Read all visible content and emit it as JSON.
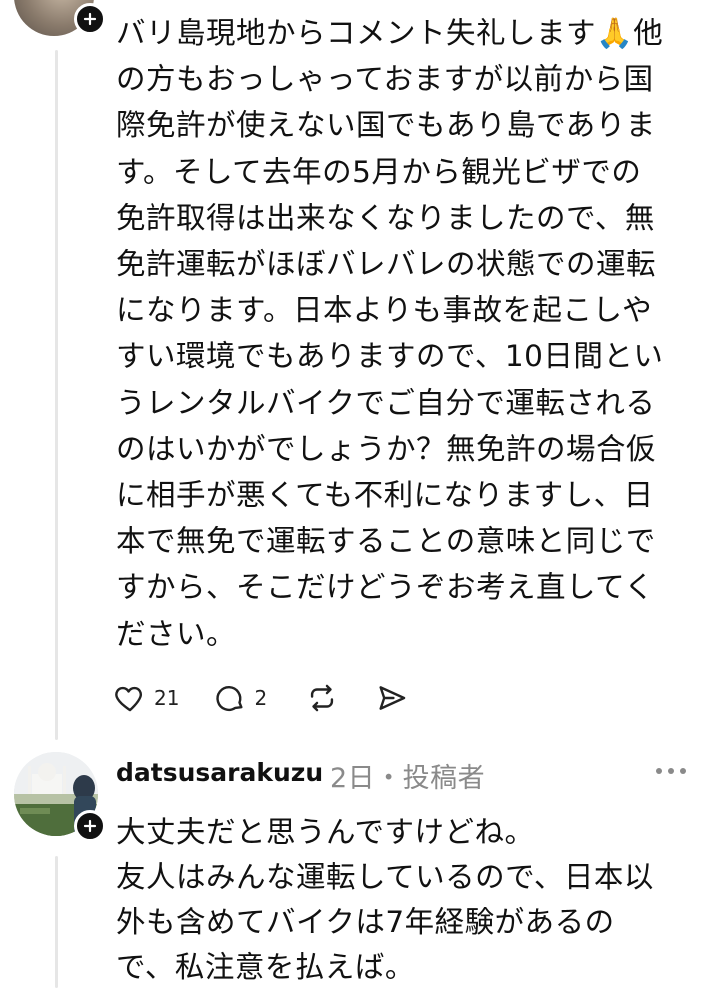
{
  "post": {
    "lines": [
      "バリ島現地からコメント失礼します🙏他",
      "の方もおっしゃっておますが以前から国",
      "際免許が使えない国でもあり島でありま",
      "す。そして去年の5月から観光ビザでの",
      "免許取得は出来なくなりましたので、無",
      "免許運転がほぼバレバレの状態での運転",
      "になります。日本よりも事故を起こしや",
      "すい環境でもありますので、10日間とい",
      "うレンタルバイクでご自分で運転される",
      "のはいかがでしょうか？無免許の場合仮",
      "に相手が悪くても不利になりますし、日",
      "本で無免で運転することの意味と同じで",
      "すから、そこだけどうぞお考え直してく",
      "ださい。"
    ],
    "likes": "21",
    "replies": "2"
  },
  "reply": {
    "username": "datsusarakuzu",
    "meta": "2日・投稿者",
    "lines": [
      "大丈夫だと思うんですけどね。",
      "友人はみんな運転しているので、日本以",
      "外も含めてバイクは7年経験があるの",
      "で、私注意を払えば。"
    ]
  },
  "icons": {
    "like": "heart-icon",
    "reply": "comment-icon",
    "repost": "repost-icon",
    "share": "send-icon",
    "follow": "plus-icon",
    "more": "more-dots-icon"
  }
}
